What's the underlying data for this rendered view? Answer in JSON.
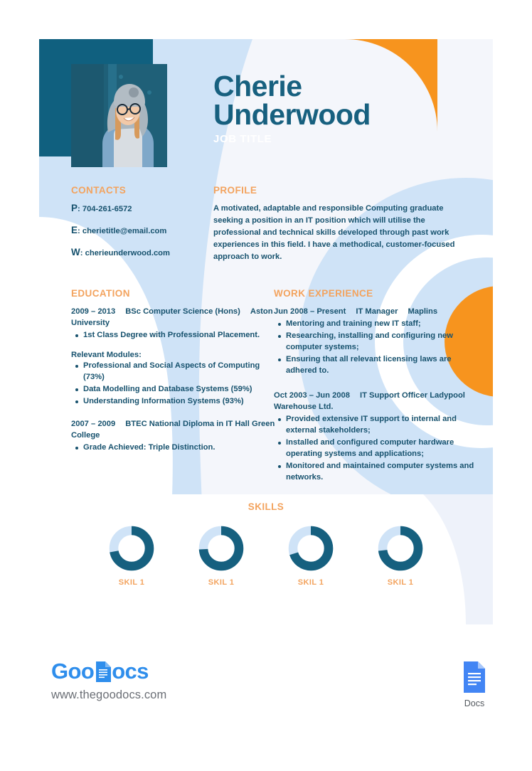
{
  "header": {
    "first_name": "Cherie",
    "last_name": "Underwood",
    "job_title": "JOB TITLE",
    "photo_alt": "portrait-photo"
  },
  "contacts": {
    "heading": "CONTACTS",
    "items": [
      {
        "key": "P",
        "value": "704-261-6572"
      },
      {
        "key": "E",
        "value": "cherietitle@email.com"
      },
      {
        "key": "W",
        "value": "cherieunderwood.com"
      }
    ]
  },
  "profile": {
    "heading": "PROFILE",
    "text": "A motivated, adaptable and responsible Computing graduate seeking a position in an IT position which will utilise the professional and technical skills developed through past work experiences in this field. I have a methodical, customer-focused approach to work."
  },
  "education": {
    "heading": "EDUCATION",
    "entries": [
      {
        "period": "2009 – 2013",
        "title": "BSc Computer Science (Hons)",
        "org": "Aston University",
        "bullets": [
          "1st Class Degree with Professional Placement."
        ]
      }
    ],
    "modules_label": "Relevant Modules:",
    "modules": [
      "Professional and Social Aspects of Computing (73%)",
      "Data Modelling and Database Systems (59%)",
      "Understanding Information Systems (93%)"
    ],
    "entries2": [
      {
        "period": "2007 – 2009",
        "title": "BTEC National Diploma in IT",
        "org": "Hall Green College",
        "bullets": [
          "Grade Achieved: Triple Distinction."
        ]
      }
    ]
  },
  "work": {
    "heading": "WORK EXPERIENCE",
    "entries": [
      {
        "period": "Jun 2008 – Present",
        "title": "IT Manager",
        "org": "Maplins",
        "bullets": [
          "Mentoring and training new IT staff;",
          "Researching, installing and configuring new computer systems;",
          "Ensuring that all relevant licensing laws are adhered to."
        ]
      },
      {
        "period": "Oct 2003 – Jun 2008",
        "title": "IT Support Officer",
        "org": "Ladypool Warehouse Ltd.",
        "bullets": [
          "Provided extensive IT support to internal and external stakeholders;",
          "Installed and configured computer hardware operating systems and applications;",
          "Monitored and maintained computer systems and networks."
        ]
      }
    ]
  },
  "skills": {
    "heading": "SKILLS",
    "items": [
      {
        "label": "SKIL 1",
        "percent": 72
      },
      {
        "label": "SKIL 1",
        "percent": 74
      },
      {
        "label": "SKIL 1",
        "percent": 70
      },
      {
        "label": "SKIL 1",
        "percent": 73
      }
    ]
  },
  "footer": {
    "logo_part1": "Goo",
    "logo_part2": "ocs",
    "url": "www.thegoodocs.com",
    "docs_label": "Docs"
  },
  "colors": {
    "teal_dark": "#17607f",
    "teal_text": "#17526e",
    "orange": "#f3a35e",
    "orange_solid": "#f7941e",
    "light_blue": "#cfe3f7",
    "card_bg": "#f4f6fb",
    "docs_blue": "#4285f4",
    "brand_blue": "#2f8eec"
  }
}
